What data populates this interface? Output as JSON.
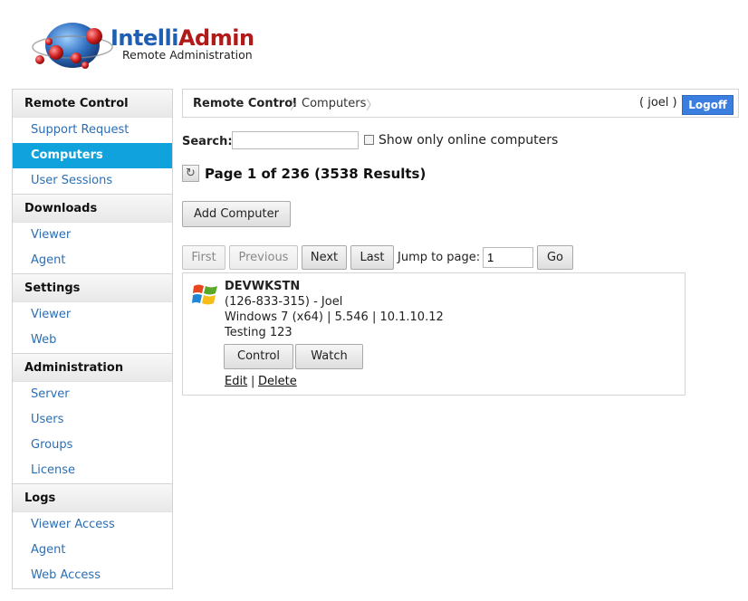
{
  "logo": {
    "brand_part1": "Intelli",
    "brand_part2": "Admin",
    "subtitle": "Remote Administration"
  },
  "sidebar": {
    "sections": [
      {
        "title": "Remote Control",
        "items": [
          {
            "label": "Support Request"
          },
          {
            "label": "Computers",
            "active": true
          },
          {
            "label": "User Sessions"
          }
        ]
      },
      {
        "title": "Downloads",
        "items": [
          {
            "label": "Viewer"
          },
          {
            "label": "Agent"
          }
        ]
      },
      {
        "title": "Settings",
        "items": [
          {
            "label": "Viewer"
          },
          {
            "label": "Web"
          }
        ]
      },
      {
        "title": "Administration",
        "items": [
          {
            "label": "Server"
          },
          {
            "label": "Users"
          },
          {
            "label": "Groups"
          },
          {
            "label": "License"
          }
        ]
      },
      {
        "title": "Logs",
        "items": [
          {
            "label": "Viewer Access"
          },
          {
            "label": "Agent"
          },
          {
            "label": "Web Access"
          }
        ]
      }
    ]
  },
  "breadcrumb": {
    "root": "Remote Control",
    "current": "Computers"
  },
  "header": {
    "user": "( joel )",
    "logoff_label": "Logoff"
  },
  "search": {
    "label": "Search:",
    "value": "",
    "placeholder": "",
    "online_only_label": "Show only online computers",
    "online_only_checked": false
  },
  "page_info": "Page 1 of 236 (3538 Results)",
  "add_computer_label": "Add Computer",
  "pagination": {
    "first": "First",
    "previous": "Previous",
    "next": "Next",
    "last": "Last",
    "jump_label": "Jump to page:",
    "jump_value": "1",
    "go": "Go"
  },
  "computer": {
    "name": "DEVWKSTN",
    "id_line": "(126-833-315) - Joel",
    "info_line": "Windows 7 (x64) | 5.546 | 10.1.10.12",
    "note": "Testing 123",
    "control_label": "Control",
    "watch_label": "Watch",
    "edit_label": "Edit",
    "separator": "|",
    "delete_label": "Delete"
  },
  "colors": {
    "accent": "#0fa2dc",
    "link": "#2a6fb5",
    "logoff": "#3a7fe0"
  }
}
